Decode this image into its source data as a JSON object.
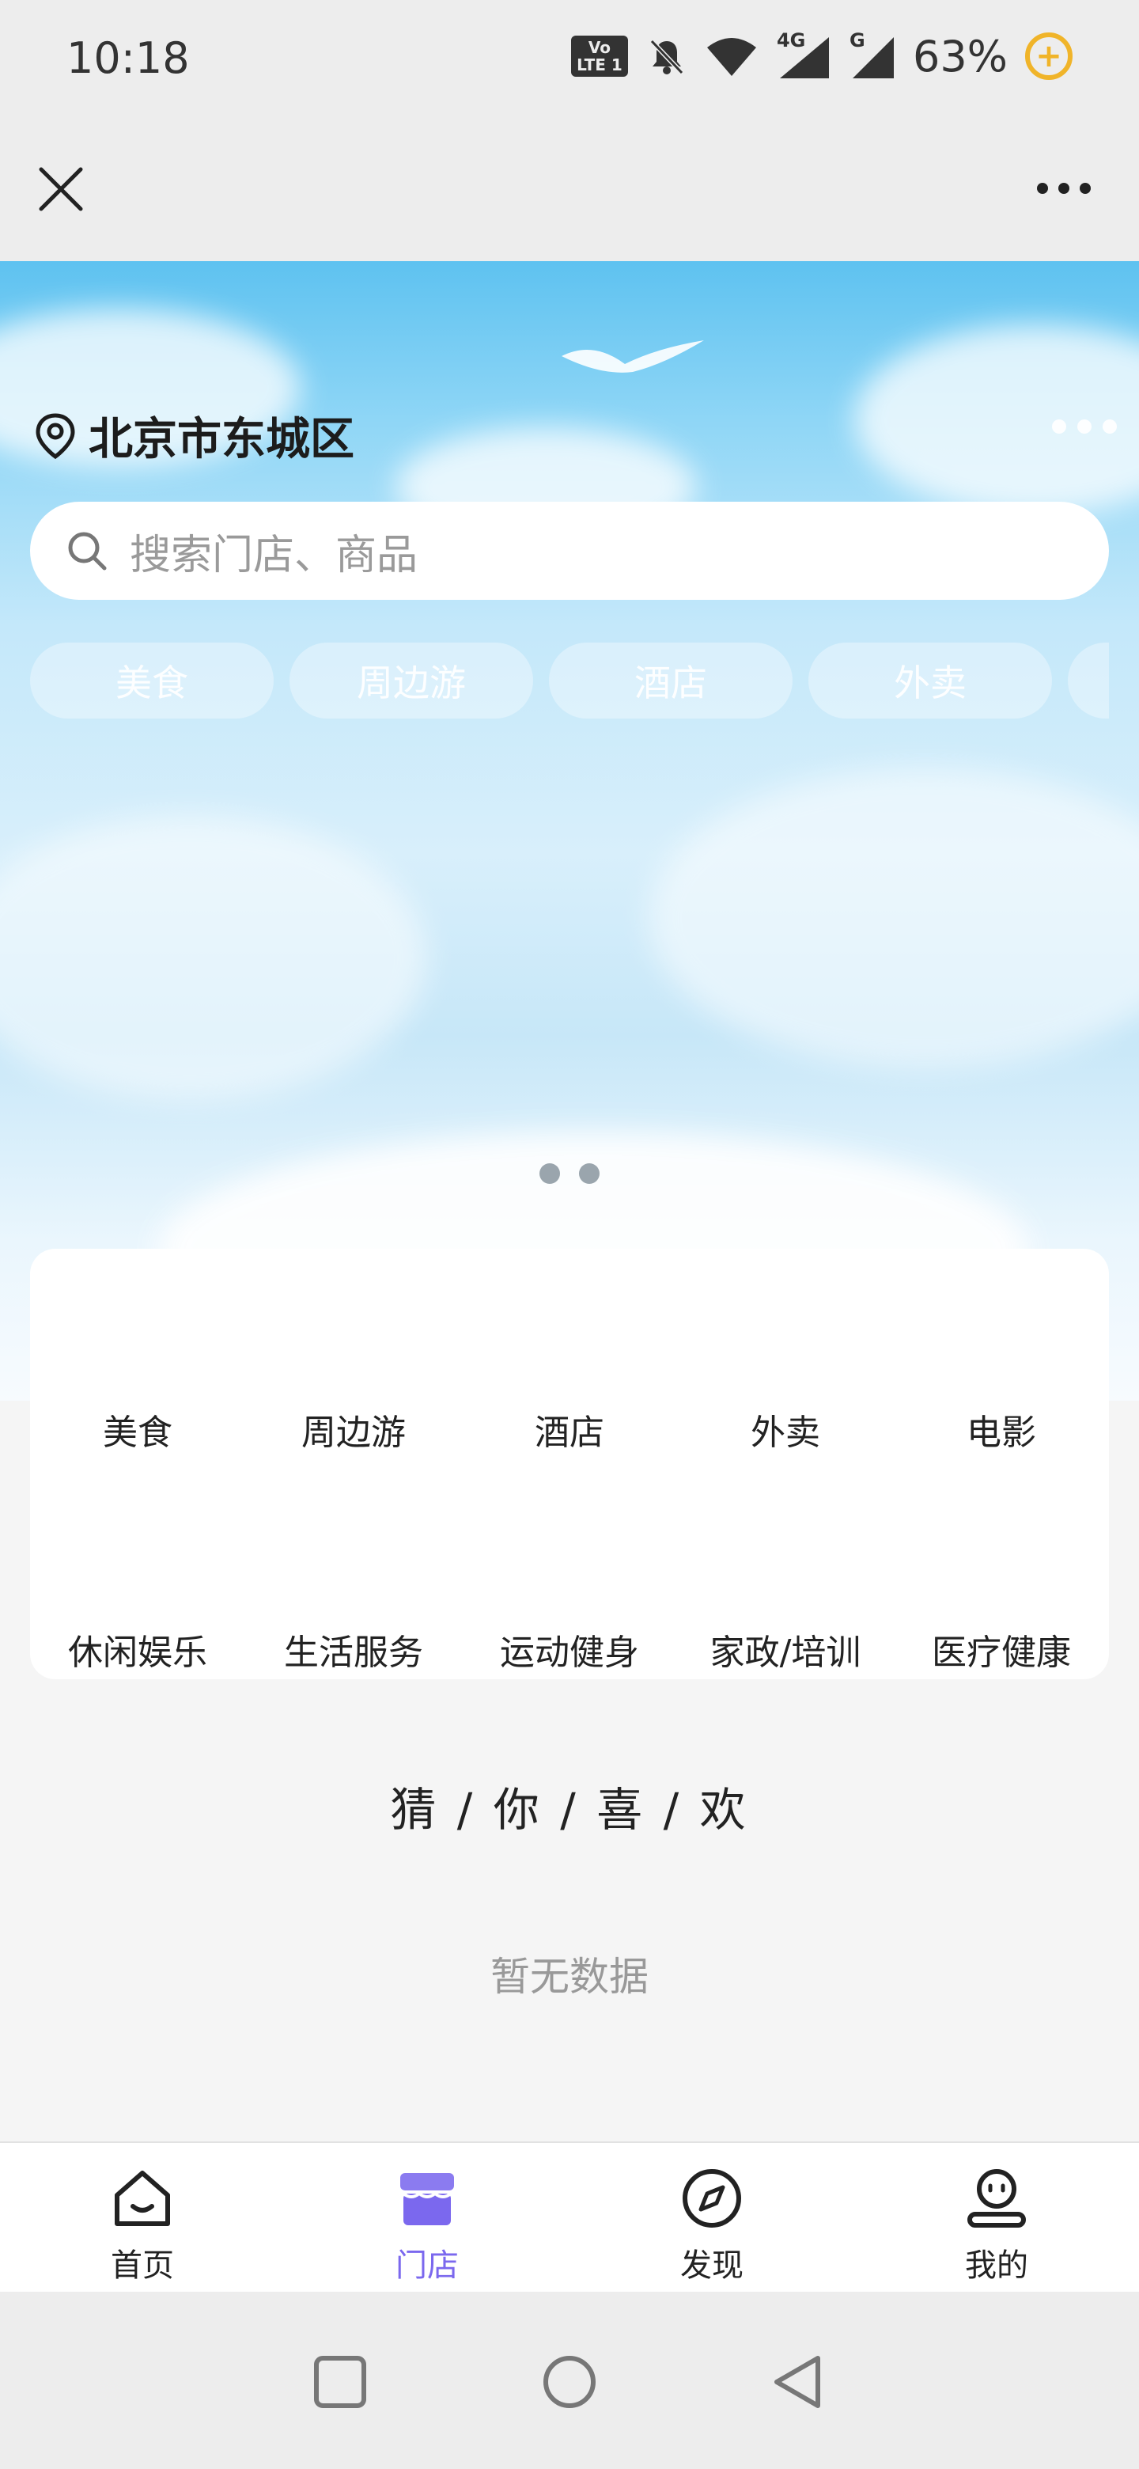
{
  "status_bar": {
    "time": "10:18",
    "volte": "Vo LTE 1",
    "network_1": "4G",
    "network_2": "G",
    "battery": "63%"
  },
  "nav_bar": {
    "close_icon": "close-icon",
    "more_icon": "more-horizontal-icon"
  },
  "hero": {
    "location": "北京市东城区",
    "search_placeholder": "搜索门店、商品",
    "chips": [
      "美食",
      "周边游",
      "酒店",
      "外卖"
    ],
    "page_count": 2
  },
  "categories": {
    "row1": [
      "美食",
      "周边游",
      "酒店",
      "外卖",
      "电影"
    ],
    "row2": [
      "休闲娱乐",
      "生活服务",
      "运动健身",
      "家政/培训",
      "医疗健康"
    ]
  },
  "guess": {
    "title": "猜 / 你 / 喜 / 欢",
    "empty": "暂无数据"
  },
  "tab_bar": {
    "items": [
      {
        "label": "首页",
        "icon": "home-icon",
        "active": false
      },
      {
        "label": "门店",
        "icon": "store-icon",
        "active": true
      },
      {
        "label": "发现",
        "icon": "compass-icon",
        "active": false
      },
      {
        "label": "我的",
        "icon": "profile-icon",
        "active": false
      }
    ],
    "active_color": "#7b68ee"
  },
  "system_nav": {
    "buttons": [
      "recents-button",
      "home-button",
      "back-button"
    ]
  }
}
